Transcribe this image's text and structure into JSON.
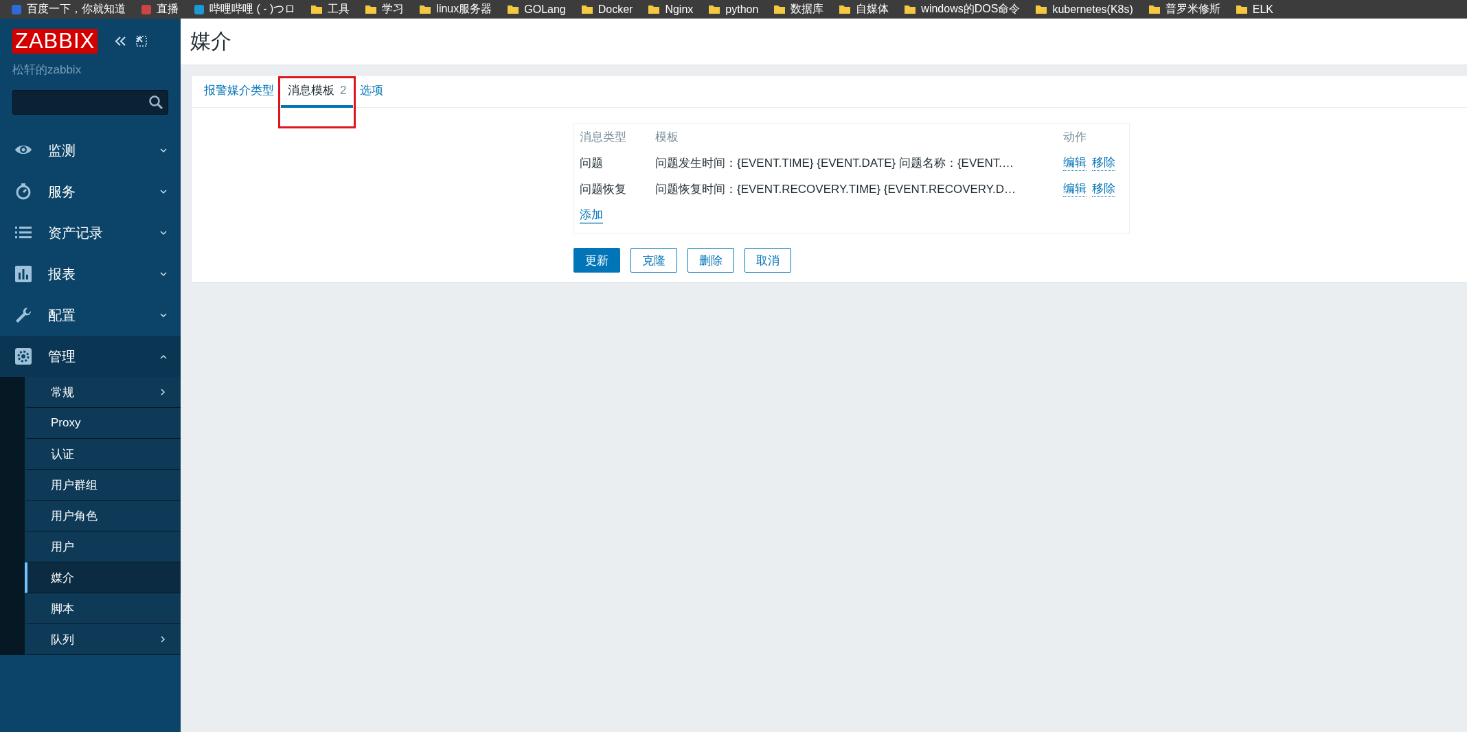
{
  "bookmarks": [
    {
      "label": "百度一下，你就知道",
      "kind": "site"
    },
    {
      "label": "直播",
      "kind": "site"
    },
    {
      "label": "哔哩哔哩 (   -   )つロ",
      "kind": "site"
    },
    {
      "label": "工具",
      "kind": "folder"
    },
    {
      "label": "学习",
      "kind": "folder"
    },
    {
      "label": "linux服务器",
      "kind": "folder"
    },
    {
      "label": "GOLang",
      "kind": "folder"
    },
    {
      "label": "Docker",
      "kind": "folder"
    },
    {
      "label": "Nginx",
      "kind": "folder"
    },
    {
      "label": "python",
      "kind": "folder"
    },
    {
      "label": "数据库",
      "kind": "folder"
    },
    {
      "label": "自媒体",
      "kind": "folder"
    },
    {
      "label": "windows的DOS命令",
      "kind": "folder"
    },
    {
      "label": "kubernetes(K8s)",
      "kind": "folder"
    },
    {
      "label": "普罗米修斯",
      "kind": "folder"
    },
    {
      "label": "ELK",
      "kind": "folder"
    }
  ],
  "sidebar": {
    "logo": "ZABBIX",
    "subtitle": "松轩的zabbix",
    "menu": [
      {
        "label": "监测",
        "expanded": false
      },
      {
        "label": "服务",
        "expanded": false
      },
      {
        "label": "资产记录",
        "expanded": false
      },
      {
        "label": "报表",
        "expanded": false
      },
      {
        "label": "配置",
        "expanded": false
      },
      {
        "label": "管理",
        "expanded": true,
        "children": [
          {
            "label": "常规",
            "selected": false,
            "submenu": true
          },
          {
            "label": "Proxy",
            "selected": false,
            "submenu": false
          },
          {
            "label": "认证",
            "selected": false,
            "submenu": false
          },
          {
            "label": "用户群组",
            "selected": false,
            "submenu": false
          },
          {
            "label": "用户角色",
            "selected": false,
            "submenu": false
          },
          {
            "label": "用户",
            "selected": false,
            "submenu": false
          },
          {
            "label": "媒介",
            "selected": true,
            "submenu": false
          },
          {
            "label": "脚本",
            "selected": false,
            "submenu": false
          },
          {
            "label": "队列",
            "selected": false,
            "submenu": true
          }
        ]
      }
    ]
  },
  "page_title": "媒介",
  "tabs": [
    {
      "label": "报警媒介类型",
      "selected": false,
      "highlighted": false
    },
    {
      "label": "消息模板",
      "count": "2",
      "selected": true,
      "highlighted": true
    },
    {
      "label": "选项",
      "selected": false,
      "highlighted": false
    }
  ],
  "templates": {
    "columns": [
      "消息类型",
      "模板",
      "动作"
    ],
    "rows": [
      {
        "type": "问题",
        "template": "问题发生时间：{EVENT.TIME} {EVENT.DATE} 问题名称：{EVENT.…",
        "actions": [
          "编辑",
          "移除"
        ]
      },
      {
        "type": "问题恢复",
        "template": "问题恢复时间：{EVENT.RECOVERY.TIME} {EVENT.RECOVERY.D…",
        "actions": [
          "编辑",
          "移除"
        ]
      }
    ],
    "add_link": "添加"
  },
  "buttons": [
    {
      "label": "更新",
      "primary": true
    },
    {
      "label": "克隆",
      "primary": false
    },
    {
      "label": "删除",
      "primary": false
    },
    {
      "label": "取消",
      "primary": false
    }
  ]
}
